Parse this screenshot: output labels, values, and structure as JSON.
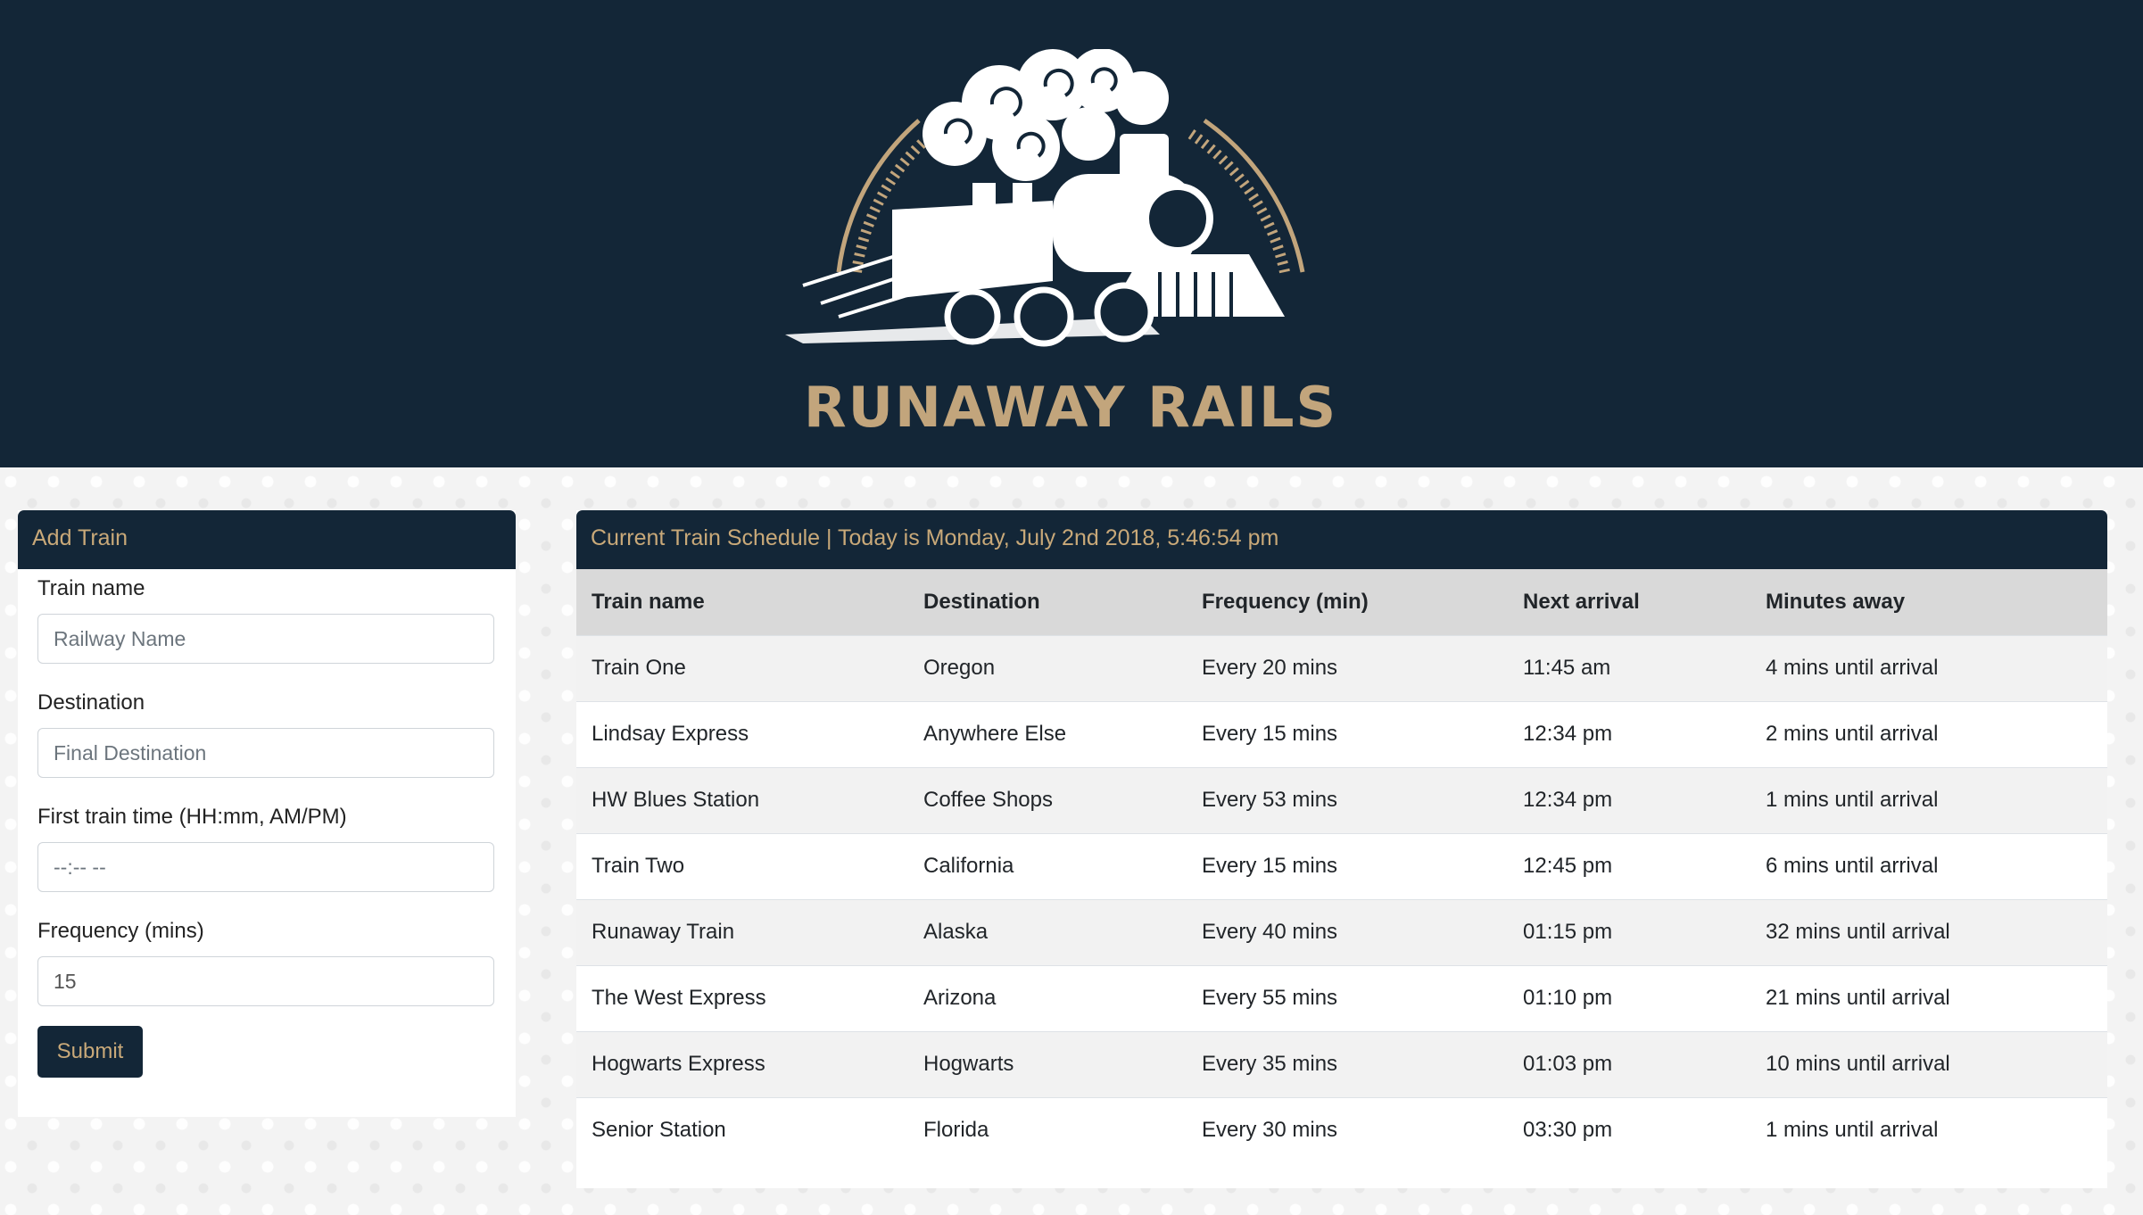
{
  "brand": {
    "logo_text": "RUNAWAY RAILS",
    "colors": {
      "navy": "#132637",
      "gold": "#c2a57c"
    }
  },
  "add_train": {
    "heading": "Add Train",
    "fields": {
      "name_label": "Train name",
      "name_placeholder": "Railway Name",
      "destination_label": "Destination",
      "destination_placeholder": "Final Destination",
      "time_label": "First train time (HH:mm, AM/PM)",
      "time_placeholder": "--:-- --",
      "frequency_label": "Frequency (mins)",
      "frequency_value": "15"
    },
    "submit_label": "Submit"
  },
  "schedule": {
    "heading": "Current Train Schedule | Today is Monday, July 2nd 2018, 5:46:54 pm",
    "columns": [
      "Train name",
      "Destination",
      "Frequency (min)",
      "Next arrival",
      "Minutes away"
    ],
    "rows": [
      [
        "Train One",
        "Oregon",
        "Every 20 mins",
        "11:45 am",
        "4 mins until arrival"
      ],
      [
        "Lindsay Express",
        "Anywhere Else",
        "Every 15 mins",
        "12:34 pm",
        "2 mins until arrival"
      ],
      [
        "HW Blues Station",
        "Coffee Shops",
        "Every 53 mins",
        "12:34 pm",
        "1 mins until arrival"
      ],
      [
        "Train Two",
        "California",
        "Every 15 mins",
        "12:45 pm",
        "6 mins until arrival"
      ],
      [
        "Runaway Train",
        "Alaska",
        "Every 40 mins",
        "01:15 pm",
        "32 mins until arrival"
      ],
      [
        "The West Express",
        "Arizona",
        "Every 55 mins",
        "01:10 pm",
        "21 mins until arrival"
      ],
      [
        "Hogwarts Express",
        "Hogwarts",
        "Every 35 mins",
        "01:03 pm",
        "10 mins until arrival"
      ],
      [
        "Senior Station",
        "Florida",
        "Every 30 mins",
        "03:30 pm",
        "1 mins until arrival"
      ]
    ]
  }
}
